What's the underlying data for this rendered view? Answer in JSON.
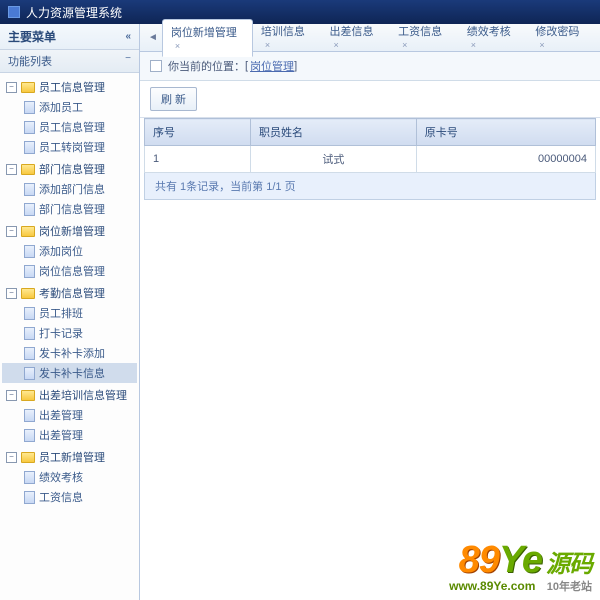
{
  "window": {
    "title": "人力资源管理系统"
  },
  "sidebar": {
    "main_menu": "主要菜单",
    "func_list": "功能列表",
    "groups": [
      {
        "label": "员工信息管理",
        "children": [
          {
            "label": "添加员工"
          },
          {
            "label": "员工信息管理"
          },
          {
            "label": "员工转岗管理"
          }
        ]
      },
      {
        "label": "部门信息管理",
        "children": [
          {
            "label": "添加部门信息"
          },
          {
            "label": "部门信息管理"
          }
        ]
      },
      {
        "label": "岗位新增管理",
        "children": [
          {
            "label": "添加岗位"
          },
          {
            "label": "岗位信息管理"
          }
        ]
      },
      {
        "label": "考勤信息管理",
        "children": [
          {
            "label": "员工排班"
          },
          {
            "label": "打卡记录"
          },
          {
            "label": "发卡补卡添加"
          },
          {
            "label": "发卡补卡信息",
            "selected": true
          }
        ]
      },
      {
        "label": "出差培训信息管理",
        "children": [
          {
            "label": "出差管理"
          },
          {
            "label": "出差管理"
          }
        ]
      },
      {
        "label": "员工新增管理",
        "children": [
          {
            "label": "绩效考核"
          },
          {
            "label": "工资信息"
          }
        ]
      }
    ]
  },
  "tabs": {
    "items": [
      {
        "label": "岗位新增管理",
        "active": true
      },
      {
        "label": "培训信息"
      },
      {
        "label": "出差信息"
      },
      {
        "label": "工资信息"
      },
      {
        "label": "绩效考核"
      },
      {
        "label": "修改密码"
      }
    ]
  },
  "breadcrumb": {
    "prefix": "你当前的位置：",
    "link": "岗位管理"
  },
  "toolbar": {
    "refresh": "刷 新"
  },
  "table": {
    "headers": [
      "序号",
      "职员姓名",
      "原卡号"
    ],
    "rows": [
      {
        "no": "1",
        "name": "试式",
        "card": "00000004"
      }
    ]
  },
  "pager": {
    "text": "共有 1条记录，当前第 1/1 页"
  },
  "watermark": {
    "logo1": "89",
    "logo2": "Ye",
    "cn": "源码",
    "url": "www.89Ye.com",
    "tag": "10年老站"
  }
}
